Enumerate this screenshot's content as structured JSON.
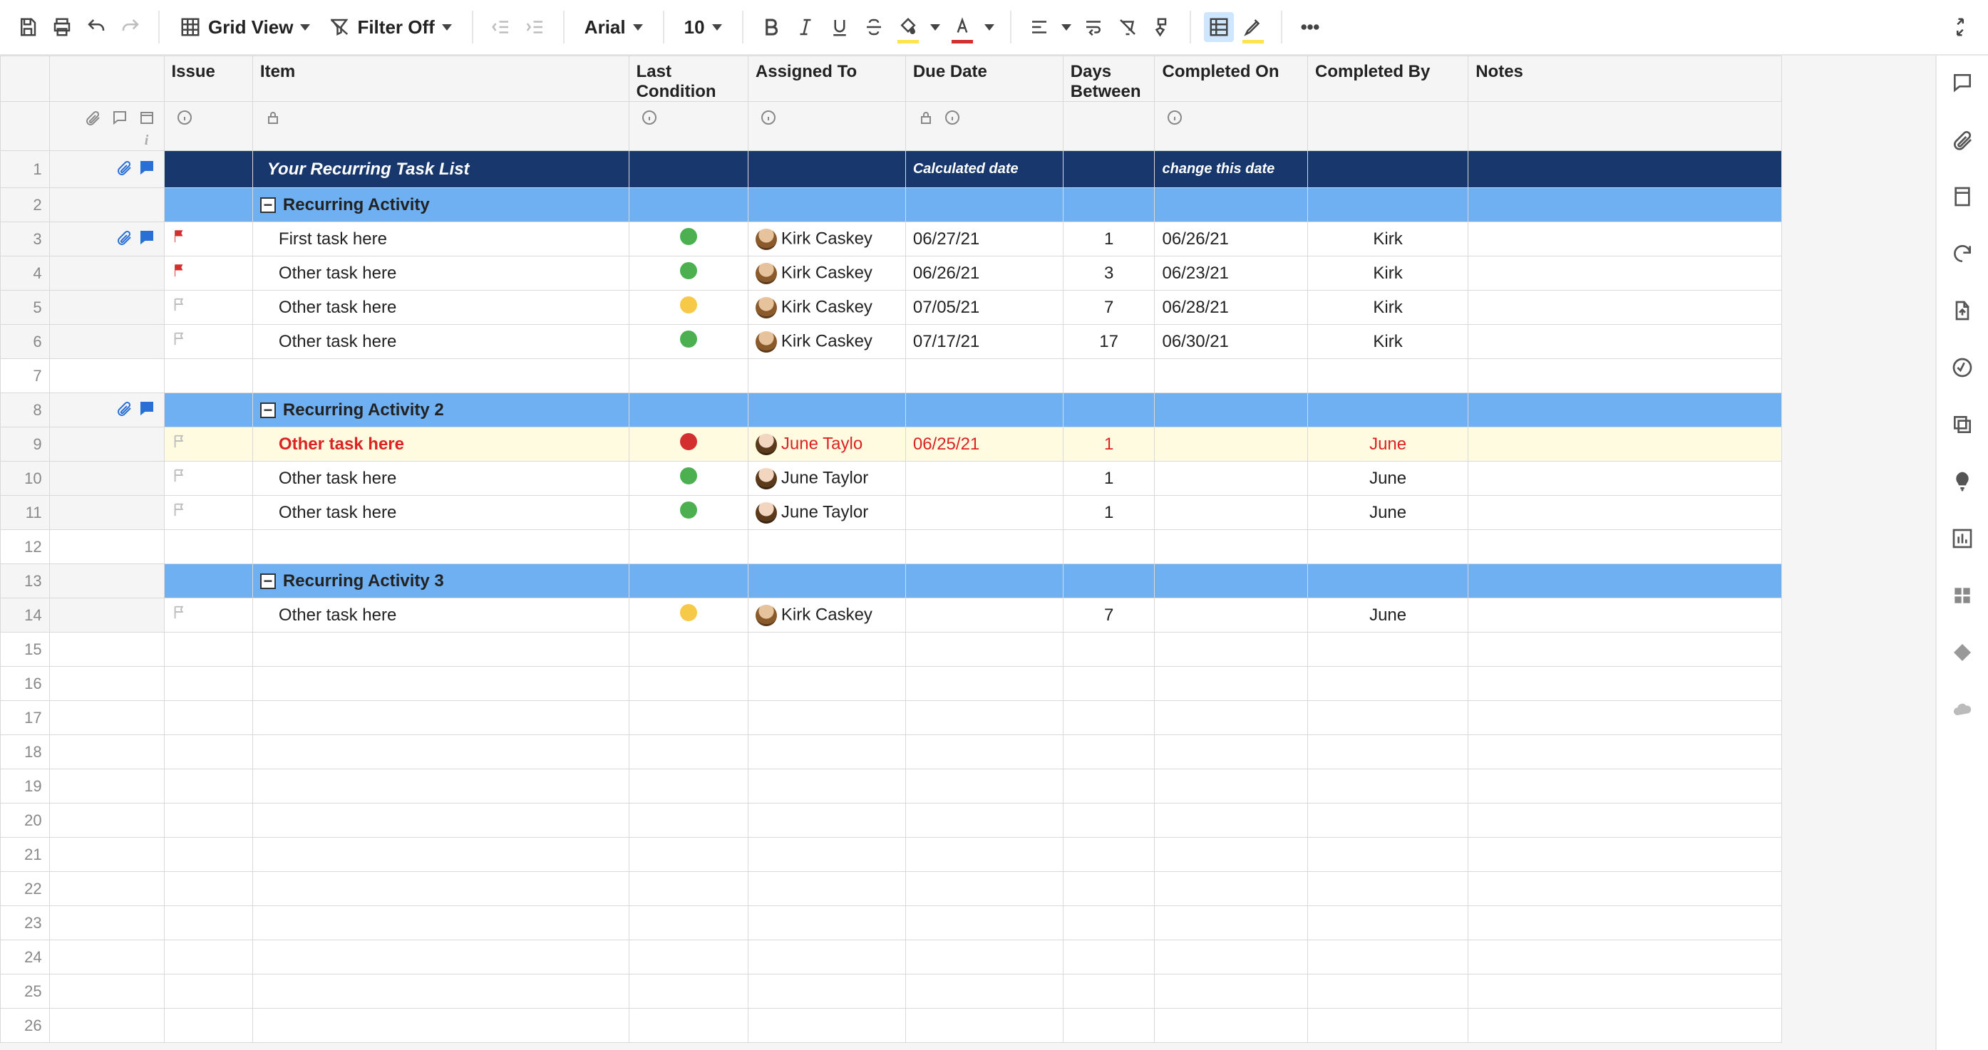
{
  "toolbar": {
    "grid_view_label": "Grid View",
    "filter_label": "Filter Off",
    "font_family": "Arial",
    "font_size": "10"
  },
  "columns": {
    "issue": "Issue",
    "item": "Item",
    "last_condition": "Last Condition",
    "assigned_to": "Assigned To",
    "due_date": "Due Date",
    "days_between": "Days Between",
    "completed_on": "Completed On",
    "completed_by": "Completed By",
    "notes": "Notes"
  },
  "title_row": {
    "item": "Your Recurring Task List",
    "due_date_hint": "Calculated date",
    "completed_on_hint": "change this date"
  },
  "sections": [
    {
      "label": "Recurring Activity"
    },
    {
      "label": "Recurring Activity 2"
    },
    {
      "label": "Recurring Activity 3"
    }
  ],
  "rows": [
    {
      "n": 3,
      "section": 0,
      "flag": "red",
      "item": "First task here",
      "cond": "green",
      "assignee": "Kirk Caskey",
      "avatar": "kirk",
      "due": "06/27/21",
      "days": "1",
      "comp_on": "06/26/21",
      "comp_by": "Kirk"
    },
    {
      "n": 4,
      "section": 0,
      "flag": "red",
      "item": "Other task here",
      "cond": "green",
      "assignee": "Kirk Caskey",
      "avatar": "kirk",
      "due": "06/26/21",
      "days": "3",
      "comp_on": "06/23/21",
      "comp_by": "Kirk"
    },
    {
      "n": 5,
      "section": 0,
      "flag": "grey",
      "item": "Other task here",
      "cond": "yellow",
      "assignee": "Kirk Caskey",
      "avatar": "kirk",
      "due": "07/05/21",
      "days": "7",
      "comp_on": "06/28/21",
      "comp_by": "Kirk"
    },
    {
      "n": 6,
      "section": 0,
      "flag": "grey",
      "item": "Other task here",
      "cond": "green",
      "assignee": "Kirk Caskey",
      "avatar": "kirk",
      "due": "07/17/21",
      "days": "17",
      "comp_on": "06/30/21",
      "comp_by": "Kirk"
    },
    {
      "n": 9,
      "section": 1,
      "flag": "grey",
      "item": "Other task here",
      "bold": true,
      "overdue": true,
      "cond": "red",
      "assignee": "June Taylo",
      "avatar": "june",
      "due": "06/25/21",
      "days": "1",
      "comp_on": "",
      "comp_by": "June"
    },
    {
      "n": 10,
      "section": 1,
      "flag": "grey",
      "item": "Other task here",
      "cond": "green",
      "assignee": "June Taylor",
      "avatar": "june",
      "due": "",
      "days": "1",
      "comp_on": "",
      "comp_by": "June"
    },
    {
      "n": 11,
      "section": 1,
      "flag": "grey",
      "item": "Other task here",
      "cond": "green",
      "assignee": "June Taylor",
      "avatar": "june",
      "due": "",
      "days": "1",
      "comp_on": "",
      "comp_by": "June"
    },
    {
      "n": 14,
      "section": 2,
      "flag": "grey",
      "item": "Other task here",
      "cond": "yellow",
      "assignee": "Kirk Caskey",
      "avatar": "kirk",
      "due": "",
      "days": "7",
      "comp_on": "",
      "comp_by": "June"
    }
  ],
  "row_numbers": [
    1,
    2,
    3,
    4,
    5,
    6,
    7,
    8,
    9,
    10,
    11,
    12,
    13,
    14,
    15,
    16,
    17,
    18,
    19,
    20,
    21,
    22,
    23,
    24,
    25,
    26
  ]
}
